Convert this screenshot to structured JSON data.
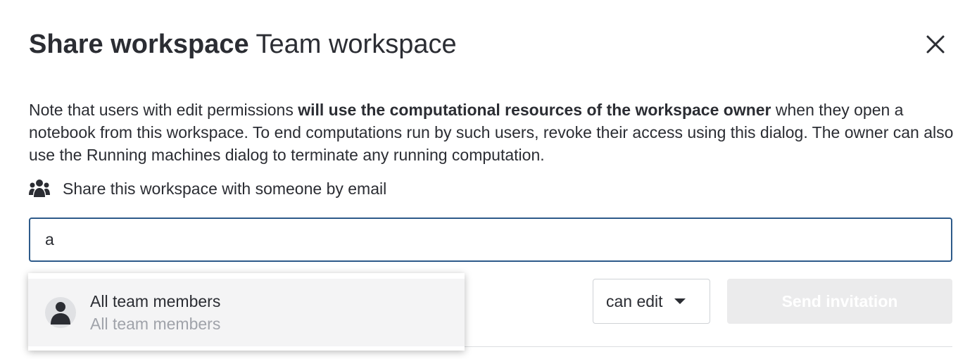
{
  "dialog": {
    "title_bold": "Share workspace",
    "title_name": "Team workspace",
    "close_icon": "close-icon"
  },
  "note": {
    "before": "Note that users with edit permissions ",
    "bold": "will use the computational resources of the workspace owner",
    "after": " when they open a notebook from this workspace. To end computations run by such users, revoke their access using this dialog. The owner can also use the Running machines dialog to terminate any running computation."
  },
  "share": {
    "icon": "users-icon",
    "label": "Share this workspace with someone by email",
    "input_value": "a"
  },
  "permission": {
    "selected": "can edit",
    "icon": "caret-down-icon"
  },
  "send_button": {
    "label": "Send invitation"
  },
  "suggestions": [
    {
      "title": "All team members",
      "subtitle": "All team members",
      "icon": "user-avatar-icon"
    }
  ]
}
